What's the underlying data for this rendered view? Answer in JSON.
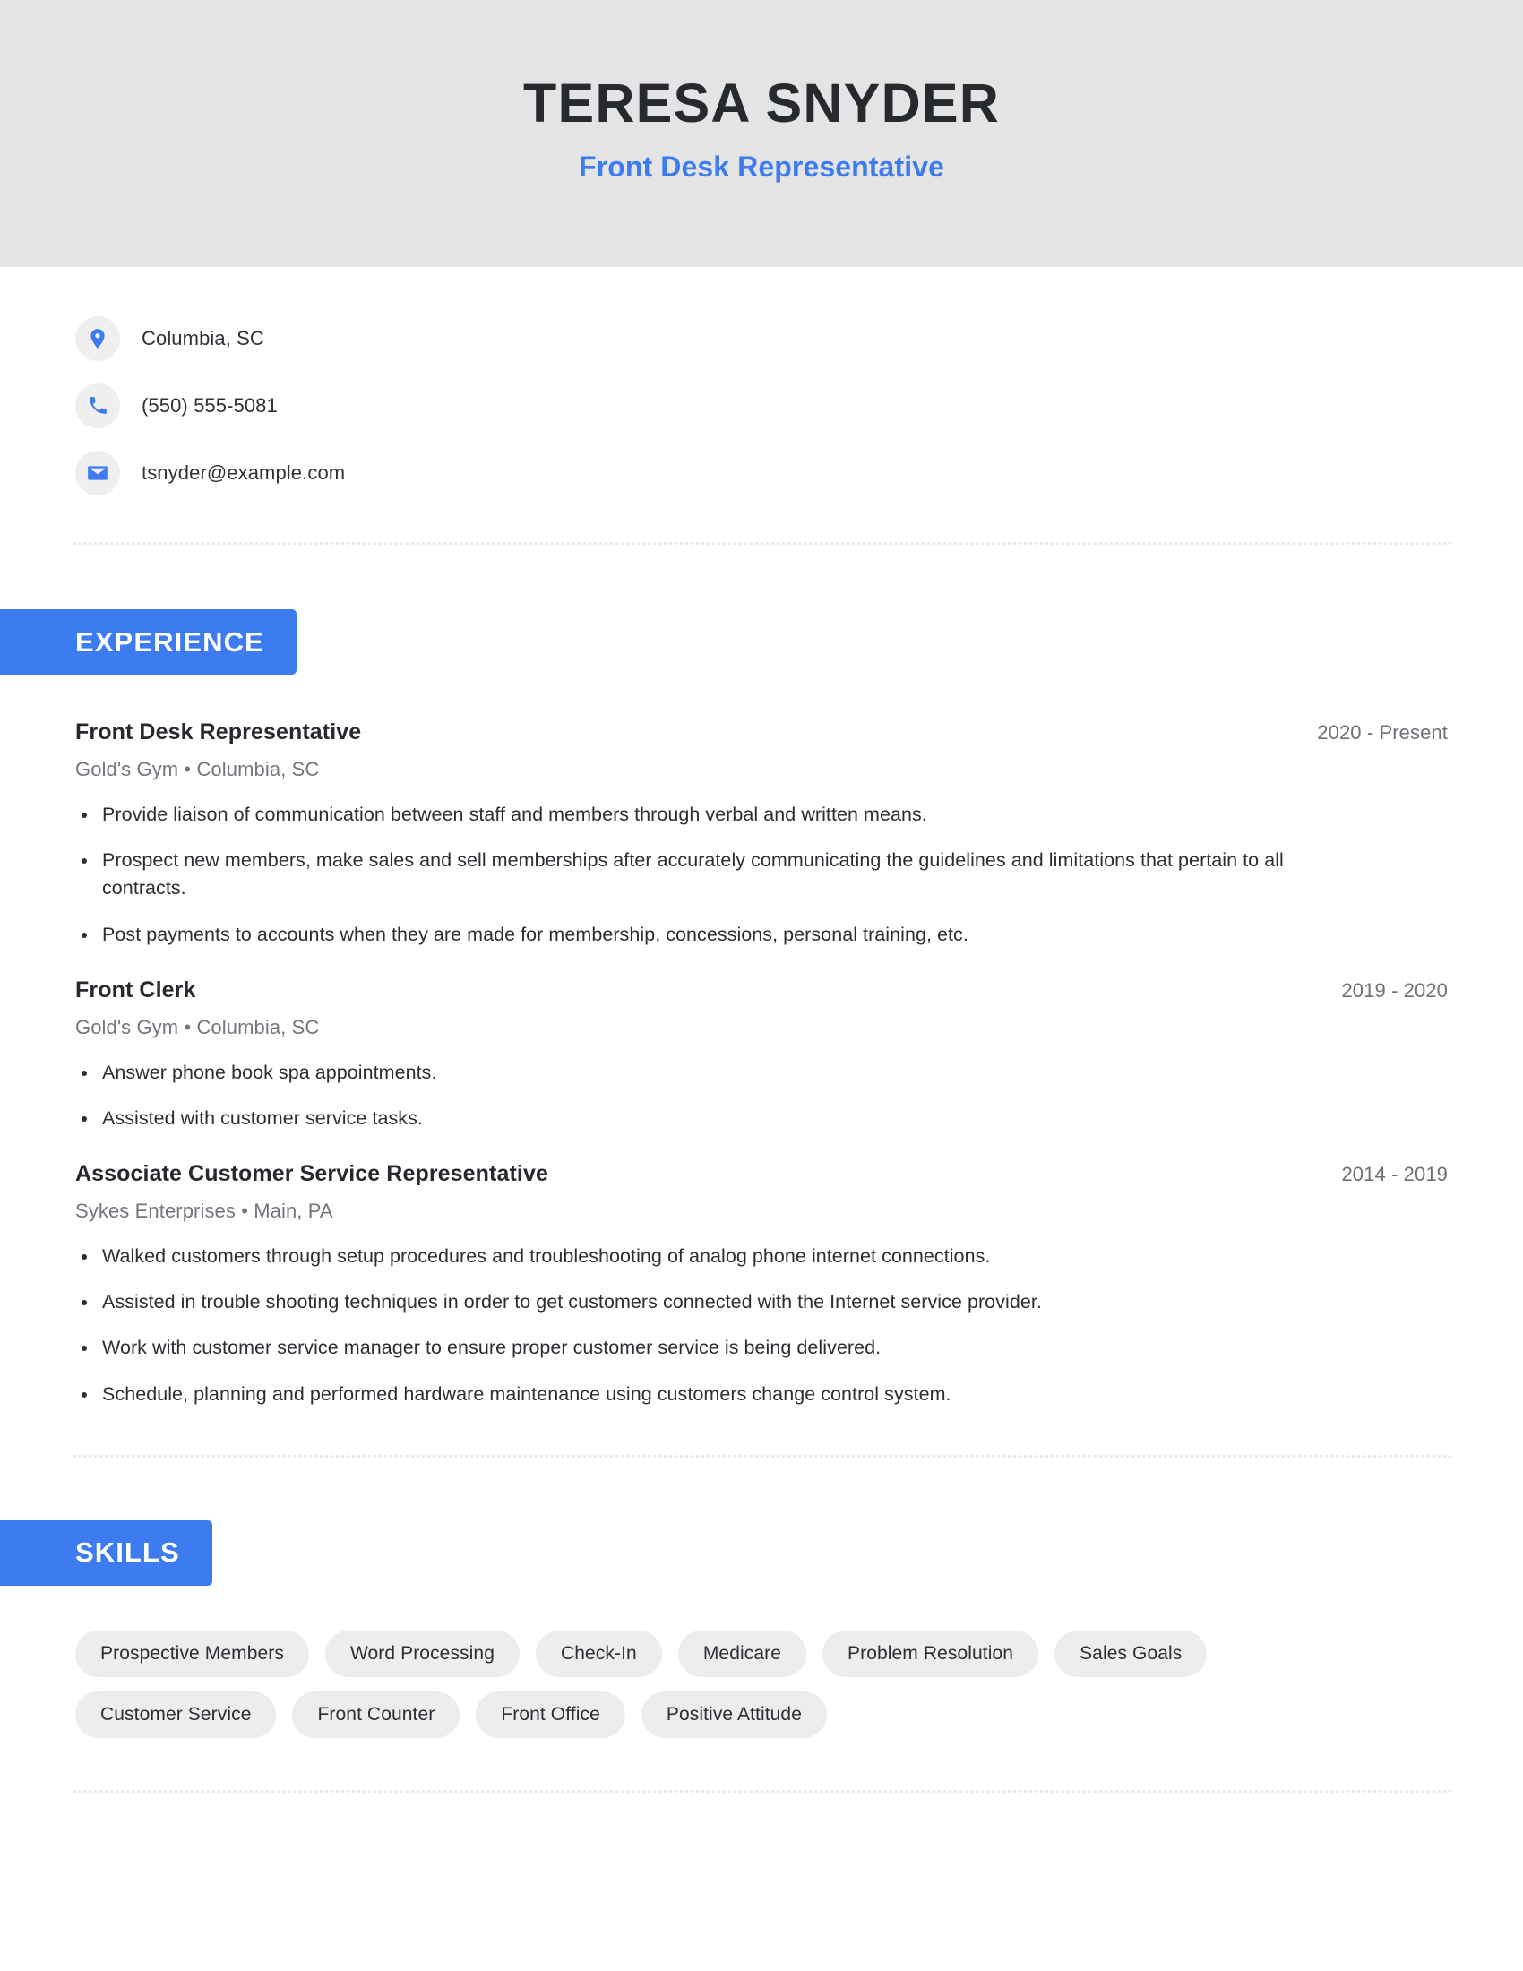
{
  "theme": {
    "accent_blue": "#3d7bf0",
    "header_band_gray": "#e4e4e4",
    "pill_gray": "#ededee",
    "icon_circle_gray": "#efefef",
    "text_dark": "#26292e",
    "text_muted": "#72767d"
  },
  "header": {
    "name": "TERESA SNYDER",
    "headline": "Front Desk Representative"
  },
  "contact": {
    "items": [
      {
        "icon": "location-pin-icon",
        "value": "Columbia, SC"
      },
      {
        "icon": "phone-icon",
        "value": "(550) 555-5081"
      },
      {
        "icon": "envelope-icon",
        "value": "tsnyder@example.com"
      }
    ]
  },
  "sections": {
    "experience": {
      "title": "EXPERIENCE",
      "jobs": [
        {
          "title": "Front Desk Representative",
          "dates": "2020 - Present",
          "company": "Gold's Gym",
          "location": "Columbia, SC",
          "meta": "Gold's Gym  • Columbia, SC",
          "bullets": [
            "Provide liaison of communication between staff and members through verbal and written means.",
            "Prospect new members, make sales and sell memberships after accurately communicating the guidelines and limitations that pertain to all contracts.",
            "Post payments to accounts when they are made for membership, concessions, personal training, etc."
          ]
        },
        {
          "title": "Front Clerk",
          "dates": "2019 - 2020",
          "company": "Gold's Gym",
          "location": "Columbia, SC",
          "meta": "Gold's Gym  • Columbia, SC",
          "bullets": [
            "Answer phone book spa appointments.",
            "Assisted with customer service tasks."
          ]
        },
        {
          "title": "Associate Customer Service Representative",
          "dates": "2014 - 2019",
          "company": "Sykes Enterprises",
          "location": "Main, PA",
          "meta": "Sykes Enterprises • Main, PA",
          "bullets": [
            "Walked customers through setup procedures and troubleshooting of analog phone internet connections.",
            "Assisted in trouble shooting techniques in order to get customers connected with the Internet service provider.",
            "Work with customer service manager to ensure proper customer service is being delivered.",
            "Schedule, planning and performed hardware maintenance using customers change control system."
          ]
        }
      ]
    },
    "skills": {
      "title": "SKILLS",
      "items": [
        "Prospective Members",
        "Word Processing",
        "Check-In",
        "Medicare",
        "Problem Resolution",
        "Sales Goals",
        "Customer Service",
        "Front Counter",
        "Front Office",
        "Positive Attitude"
      ]
    }
  }
}
